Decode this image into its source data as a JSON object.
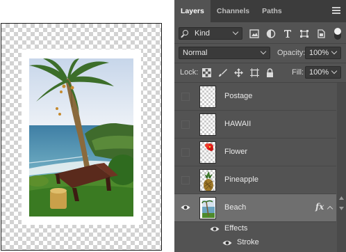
{
  "panel": {
    "tabs": [
      {
        "label": "Layers",
        "active": true
      },
      {
        "label": "Channels",
        "active": false
      },
      {
        "label": "Paths",
        "active": false
      }
    ]
  },
  "filter": {
    "kind_label": "Kind",
    "icons": [
      "image-filter-icon",
      "adjustment-filter-icon",
      "type-filter-icon",
      "shape-filter-icon",
      "smart-object-filter-icon"
    ]
  },
  "blend": {
    "mode": "Normal",
    "opacity_label": "Opacity:",
    "opacity_value": "100%"
  },
  "lock": {
    "label": "Lock:",
    "fill_label": "Fill:",
    "fill_value": "100%",
    "icons": [
      "lock-transparent-pixels-icon",
      "lock-image-pixels-icon",
      "lock-position-icon",
      "lock-artboard-icon",
      "lock-all-icon"
    ]
  },
  "layers": [
    {
      "name": "Postage",
      "visible": false,
      "selected": false
    },
    {
      "name": "HAWAII",
      "visible": false,
      "selected": false
    },
    {
      "name": "Flower",
      "visible": false,
      "selected": false
    },
    {
      "name": "Pineapple",
      "visible": false,
      "selected": false
    },
    {
      "name": "Beach",
      "visible": true,
      "selected": true,
      "fx": "fx"
    }
  ],
  "effects": {
    "label": "Effects",
    "items": [
      "Stroke"
    ]
  },
  "colors": {
    "panel_bg": "#535353",
    "tab_bar_bg": "#3c3c3c",
    "selected_layer_bg": "#6f6f6f"
  }
}
